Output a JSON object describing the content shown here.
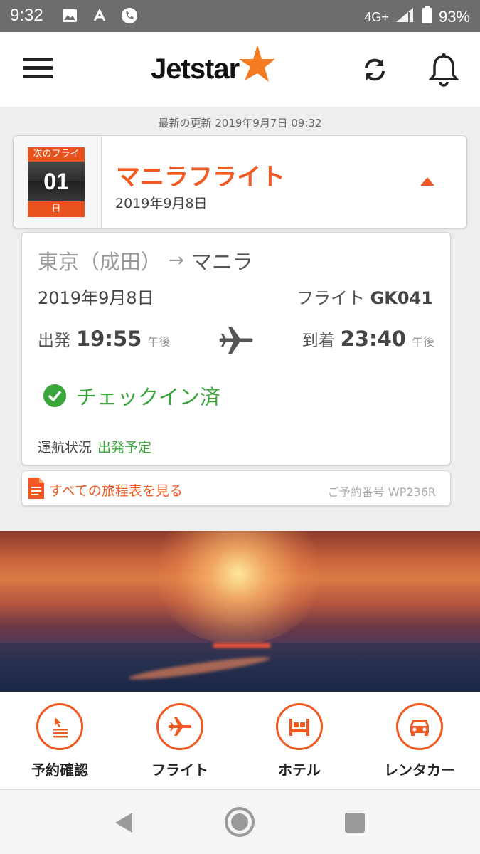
{
  "status_bar": {
    "time": "9:32",
    "network": "4G+",
    "battery": "93%",
    "icons": [
      "image-icon",
      "signal-boost-icon",
      "phone-icon",
      "signal-icon",
      "battery-icon"
    ]
  },
  "header": {
    "logo_text": "Jetstar",
    "brand_color": "#f05a22",
    "icons": [
      "menu-icon",
      "refresh-icon",
      "bell-icon"
    ]
  },
  "last_updated": "最新の更新 2019年9月7日 09:32",
  "next_flight": {
    "calendar_top": "次のフライ",
    "calendar_number": "01",
    "calendar_unit": "日",
    "title": "マニラフライト",
    "date": "2019年9月8日"
  },
  "flight_detail": {
    "from": "東京（成田）",
    "arrow": "→",
    "to": "マニラ",
    "date": "2019年9月8日",
    "flight_label": "フライト",
    "flight_number": "GK041",
    "departure_label": "出発",
    "departure_time": "19:55",
    "departure_ampm": "午後",
    "arrival_label": "到着",
    "arrival_time": "23:40",
    "arrival_ampm": "午後",
    "checkin_status": "チェックイン済",
    "operation_label": "運航状況",
    "operation_status": "出発予定",
    "status_color": "#3aa53a"
  },
  "itinerary": {
    "link_label": "すべての旅程表を見る",
    "booking_ref": "ご予約番号 WP236R"
  },
  "bottom_nav": [
    {
      "label": "予約確認",
      "icon": "booking-icon"
    },
    {
      "label": "フライト",
      "icon": "plane-icon"
    },
    {
      "label": "ホテル",
      "icon": "bed-icon"
    },
    {
      "label": "レンタカー",
      "icon": "car-icon"
    }
  ]
}
